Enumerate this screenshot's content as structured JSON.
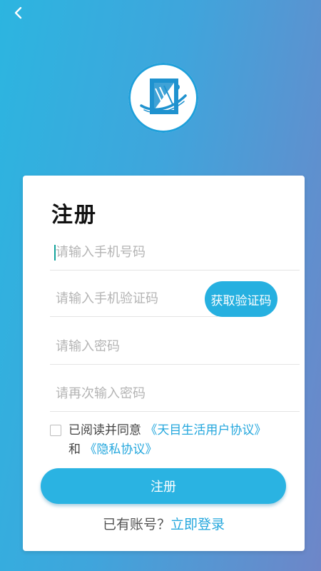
{
  "nav": {
    "back_icon": "chevron-left-icon"
  },
  "logo": {
    "icon": "app-logo"
  },
  "form": {
    "title": "注册",
    "phone_placeholder": "请输入手机号码",
    "code_placeholder": "请输入手机验证码",
    "get_code_label": "获取验证码",
    "password_placeholder": "请输入密码",
    "password_confirm_placeholder": "请再次输入密码"
  },
  "agreement": {
    "checked": false,
    "prefix": "已阅读并同意",
    "user_agreement": "《天目生活用户协议》",
    "and": "和",
    "privacy_policy": "《隐私协议》"
  },
  "register_label": "注册",
  "login": {
    "prompt": "已有账号？",
    "link": "立即登录"
  },
  "colors": {
    "accent": "#2ab3e2",
    "link": "#24a7dd",
    "gradient_start": "#2cb5e0",
    "gradient_end": "#6e86c8"
  }
}
